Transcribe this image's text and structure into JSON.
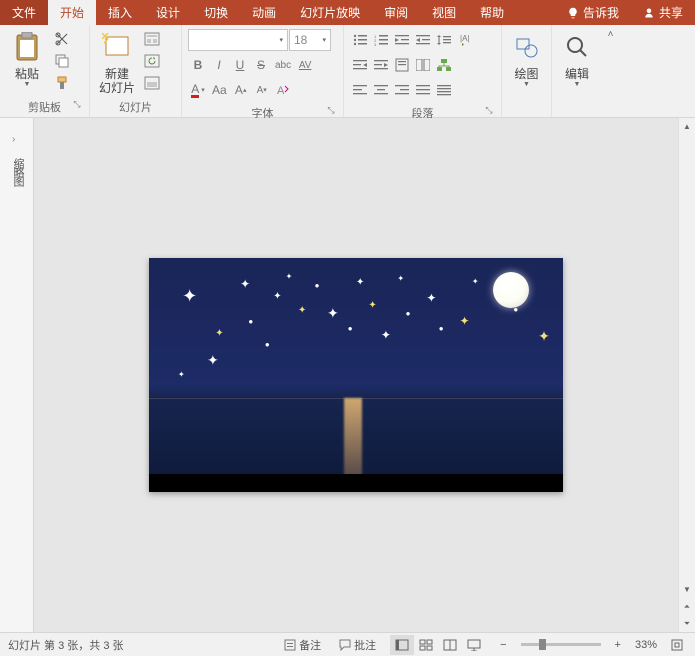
{
  "tabs": {
    "file": "文件",
    "home": "开始",
    "insert": "插入",
    "design": "设计",
    "transitions": "切换",
    "animations": "动画",
    "slideshow": "幻灯片放映",
    "review": "审阅",
    "view": "视图",
    "help": "帮助",
    "tell_me": "告诉我",
    "share": "共享"
  },
  "ribbon": {
    "clipboard": {
      "paste": "粘贴",
      "label": "剪贴板"
    },
    "slides": {
      "new_slide": "新建\n幻灯片",
      "label": "幻灯片"
    },
    "font": {
      "size_value": "18",
      "bold": "B",
      "italic": "I",
      "underline": "U",
      "strike": "S",
      "char_spacing": "AV",
      "change_case": "Aa",
      "grow": "A",
      "shrink": "A",
      "font_color": "A",
      "highlight": "abc",
      "label": "字体"
    },
    "paragraph": {
      "label": "段落"
    },
    "drawing": {
      "btn": "绘图",
      "label": ""
    },
    "editing": {
      "btn": "编辑",
      "label": ""
    }
  },
  "outline": {
    "title": "缩略图"
  },
  "status": {
    "slide_info": "幻灯片 第 3 张，共 3 张",
    "notes": "备注",
    "comments": "批注",
    "zoom_pct": "33%"
  }
}
